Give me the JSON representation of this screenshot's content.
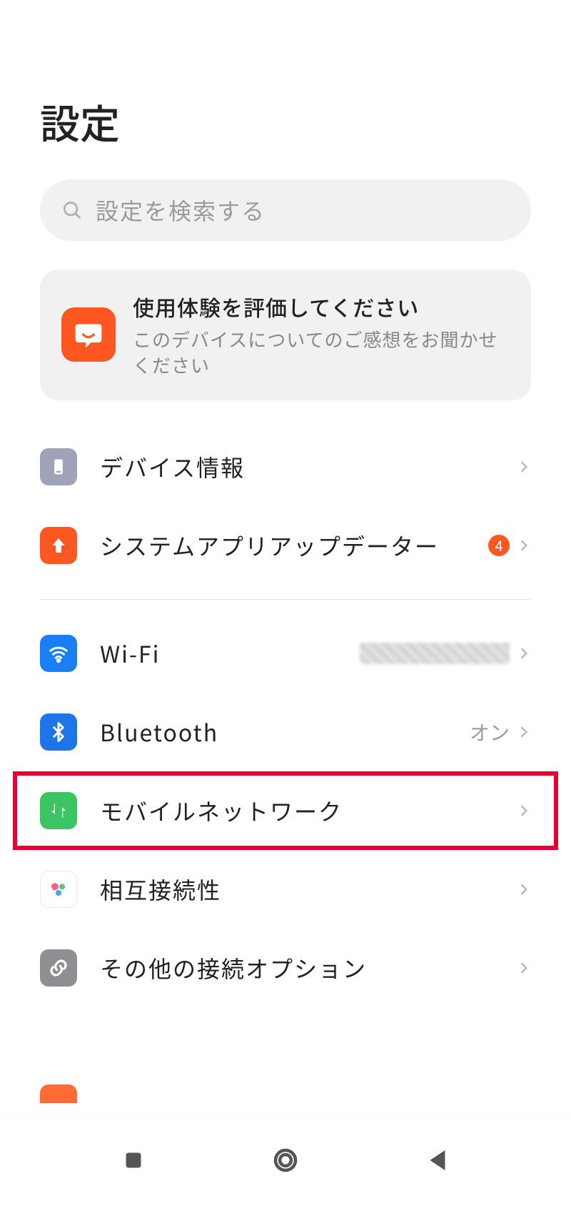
{
  "header": {
    "title": "設定"
  },
  "search": {
    "placeholder": "設定を検索する"
  },
  "feedback": {
    "title": "使用体験を評価してください",
    "subtitle": "このデバイスについてのご感想をお聞かせください",
    "icon": "chat-smile-icon"
  },
  "items": [
    {
      "label": "デバイス情報",
      "icon": "phone-icon",
      "bg": "bg-gray"
    },
    {
      "label": "システムアプリアップデーター",
      "icon": "arrow-up-icon",
      "bg": "bg-orange",
      "badge": "4"
    }
  ],
  "connectivity": [
    {
      "label": "Wi-Fi",
      "icon": "wifi-icon",
      "bg": "bg-blue1",
      "value_obscured": true
    },
    {
      "label": "Bluetooth",
      "icon": "bluetooth-icon",
      "bg": "bg-blue2",
      "value": "オン"
    },
    {
      "label": "モバイルネットワーク",
      "icon": "mobile-data-icon",
      "bg": "bg-green",
      "highlighted": true
    },
    {
      "label": "相互接続性",
      "icon": "dots-colored-icon",
      "bg": "bg-white"
    },
    {
      "label": "その他の接続オプション",
      "icon": "link-icon",
      "bg": "bg-gray2"
    }
  ],
  "partial": {
    "icon": "partial-icon",
    "bg": "bg-orange2"
  },
  "nav": {
    "recent": "recent-apps-icon",
    "home": "home-icon",
    "back": "back-icon"
  }
}
